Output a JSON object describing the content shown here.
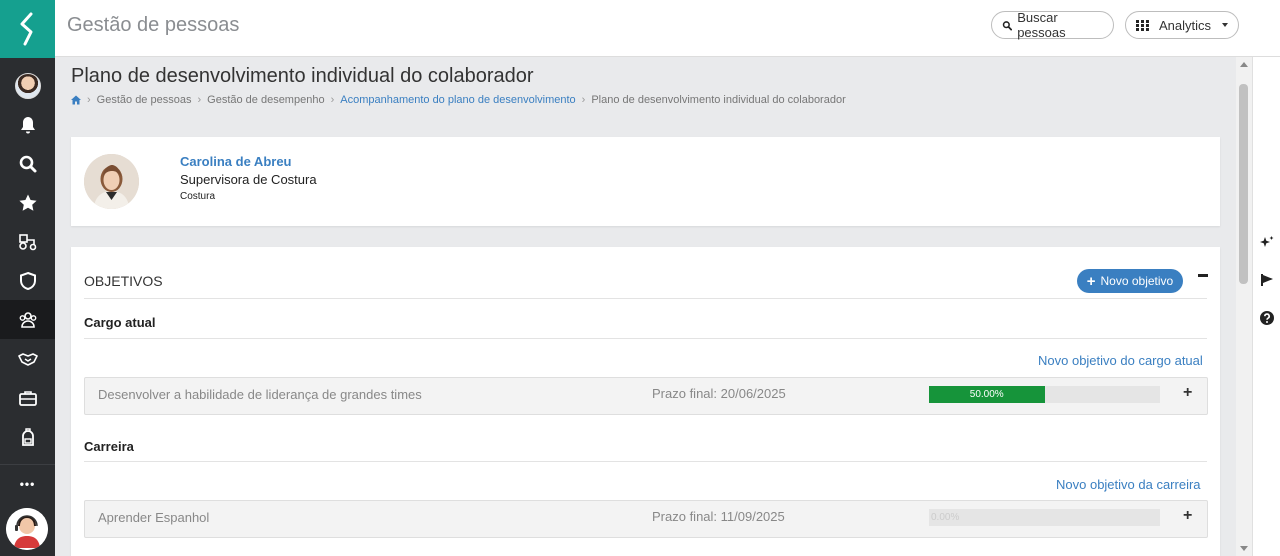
{
  "app": {
    "title": "Gestão de pessoas",
    "search_button": "Buscar pessoas",
    "analytics_button": "Analytics"
  },
  "sidebar": {
    "items": [
      "avatar",
      "bell-icon",
      "search-icon",
      "star-icon",
      "tractor-icon",
      "shield-icon",
      "users-icon",
      "handshake-icon",
      "briefcase-icon",
      "backpack-icon",
      "more-icon"
    ],
    "more_label": "•••"
  },
  "page": {
    "title": "Plano de desenvolvimento individual do colaborador",
    "breadcrumb": [
      "Gestão de pessoas",
      "Gestão de desempenho",
      "Acompanhamento do plano de desenvolvimento",
      "Plano de desenvolvimento individual do colaborador"
    ]
  },
  "employee": {
    "name": "Carolina de Abreu",
    "role": "Supervisora de Costura",
    "department": "Costura"
  },
  "objectives": {
    "header": "OBJETIVOS",
    "new_button": "Novo objetivo",
    "sections": [
      {
        "title": "Cargo atual",
        "add_link": "Novo objetivo do cargo atual",
        "items": [
          {
            "description": "Desenvolver a habilidade de liderança de grandes times",
            "deadline": "Prazo final: 20/06/2025",
            "progress_label": "50.00%",
            "progress_fraction": 0.5
          }
        ]
      },
      {
        "title": "Carreira",
        "add_link": "Novo objetivo da carreira",
        "items": [
          {
            "description": "Aprender Espanhol",
            "deadline": "Prazo final: 11/09/2025",
            "progress_label": "0.00%",
            "progress_fraction": 0
          }
        ]
      }
    ]
  },
  "colors": {
    "brand_teal": "#15a08f",
    "sidebar_bg": "#2b2d30",
    "accent_blue": "#3a7fc1",
    "progress_green": "#16943a"
  }
}
